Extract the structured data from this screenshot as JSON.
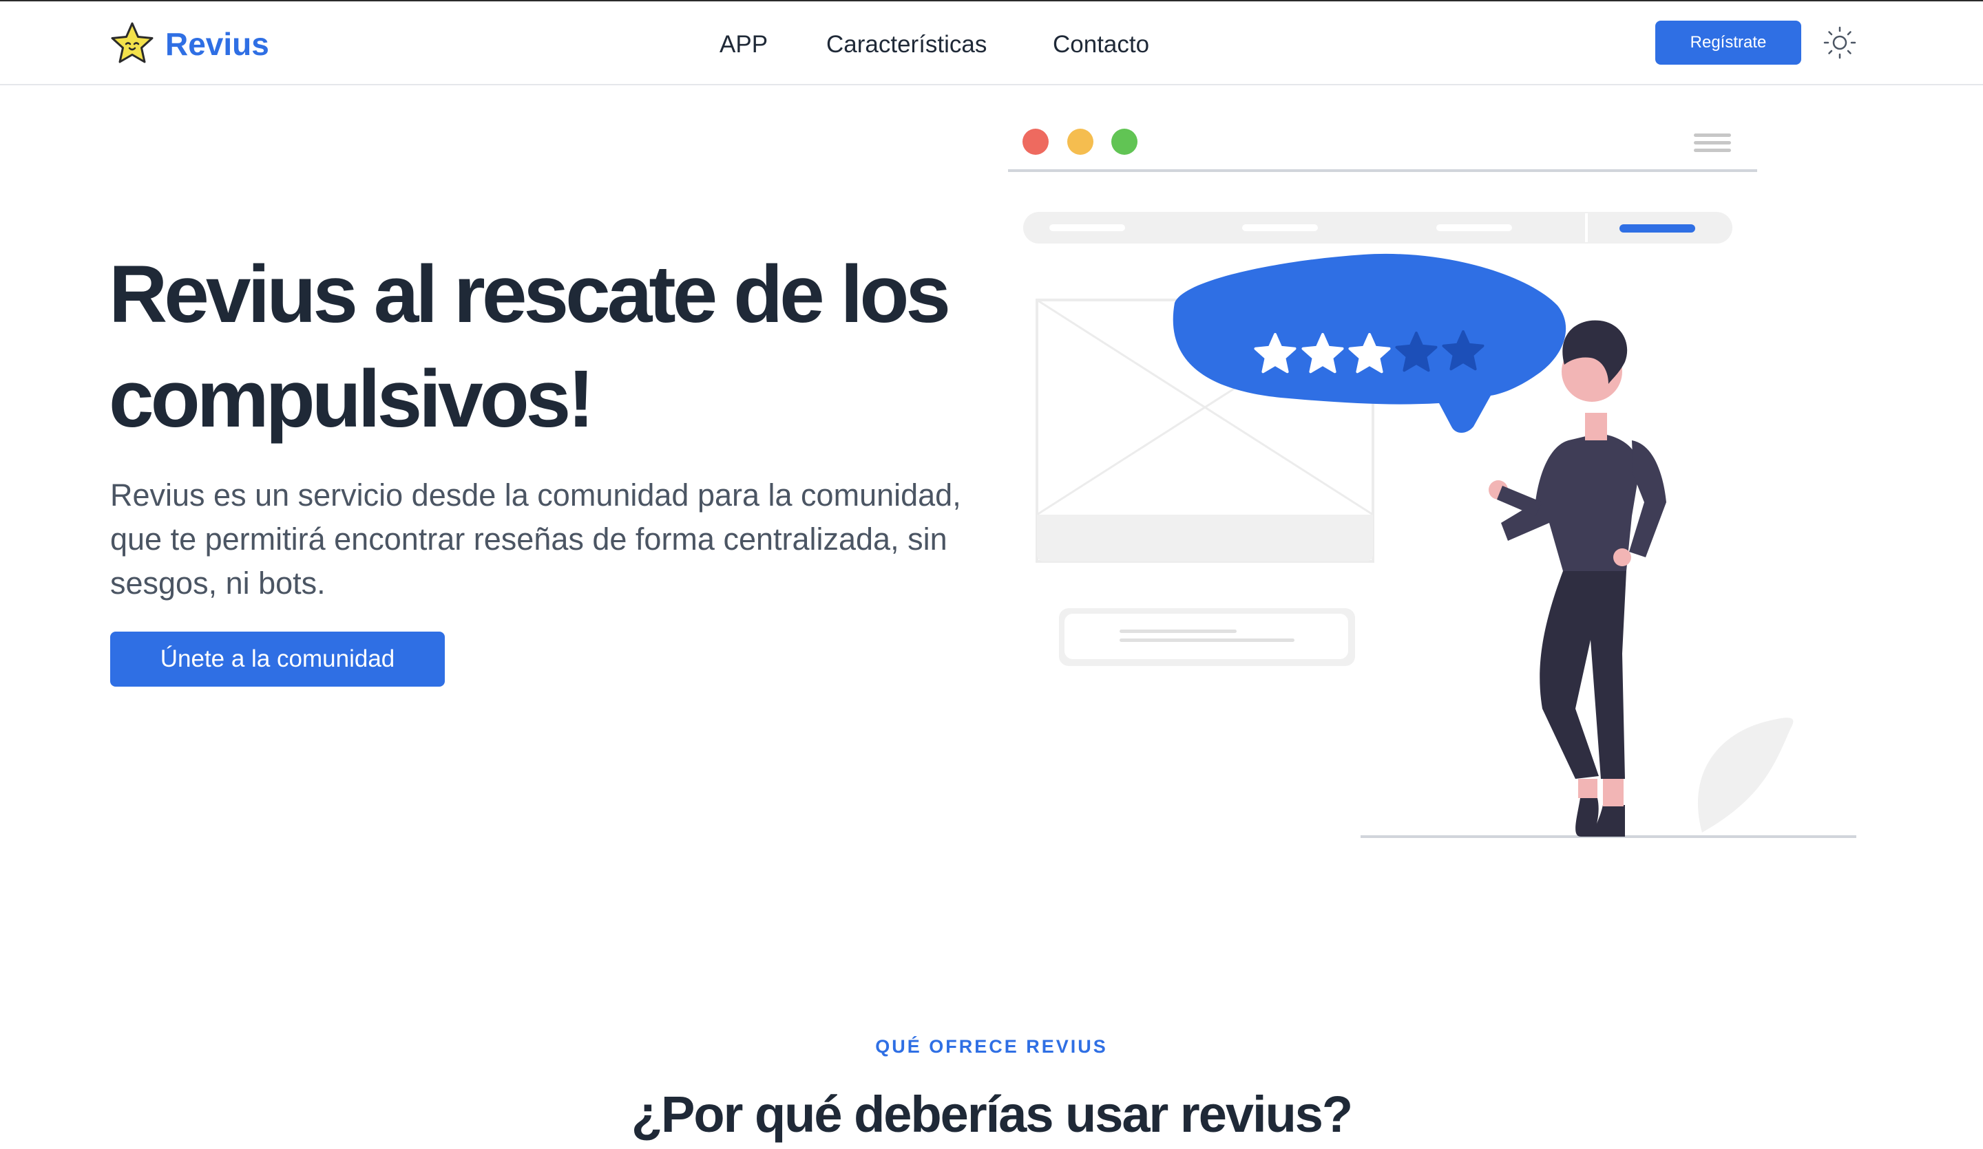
{
  "brand": {
    "name": "Revius",
    "icon": "star-icon",
    "color": "#2f6fe4"
  },
  "nav": {
    "links": [
      {
        "label": "APP"
      },
      {
        "label": "Características"
      },
      {
        "label": "Contacto"
      }
    ],
    "register_label": "Regístrate",
    "theme_toggle_icon": "sun-icon"
  },
  "hero": {
    "title": "Revius al rescate de los compulsivos!",
    "description": "Revius es un servicio desde la comunidad para la comunidad, que te permitirá encontrar reseñas de forma centralizada, sin sesgos, ni bots.",
    "cta_label": "Únete a la comunidad",
    "illustration": {
      "rating_filled": 3,
      "rating_total": 5,
      "icon": "reviews-illustration"
    }
  },
  "section": {
    "eyebrow": "QUÉ OFRECE REVIUS",
    "title": "¿Por qué deberías usar revius?"
  },
  "colors": {
    "primary": "#2f6fe4",
    "heading": "#1f2937",
    "body_text": "#4b5563",
    "window_red": "#ee6a5f",
    "window_yellow": "#f5bd4f",
    "window_green": "#61c454"
  }
}
